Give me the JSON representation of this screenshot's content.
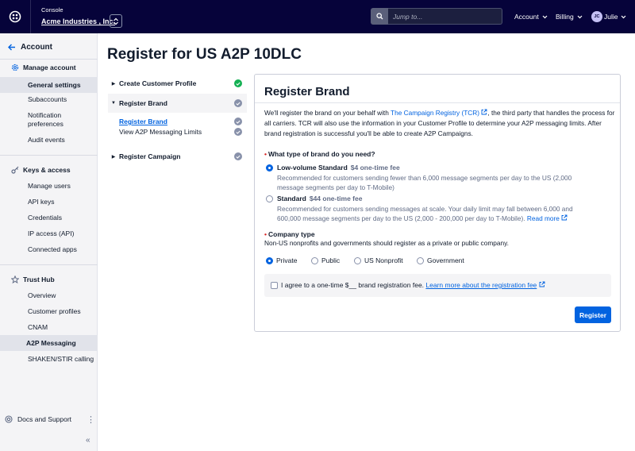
{
  "topbar": {
    "console_label": "Console",
    "account_name": "Acme Industries , Inc.",
    "search_placeholder": "Jump to...",
    "account_menu": "Account",
    "billing_menu": "Billing",
    "avatar_initials": "JC",
    "user_name": "Julie"
  },
  "sidebar": {
    "back_label": "Account",
    "manage_account": "Manage account",
    "general_settings": "General settings",
    "subaccounts": "Subaccounts",
    "notification_prefs_line1": "Notification",
    "notification_prefs_line2": "preferences",
    "audit_events": "Audit events",
    "keys_access": "Keys & access",
    "manage_users": "Manage users",
    "api_keys": "API keys",
    "credentials": "Credentials",
    "ip_access": "IP access (API)",
    "connected_apps": "Connected apps",
    "trust_hub": "Trust Hub",
    "overview": "Overview",
    "customer_profiles": "Customer profiles",
    "cnam": "CNAM",
    "a2p_messaging": "A2P Messaging",
    "shaken_stir": "SHAKEN/STIR calling",
    "docs_support": "Docs and Support"
  },
  "page": {
    "title": "Register for US A2P 10DLC"
  },
  "steps": {
    "create_profile": "Create Customer Profile",
    "register_brand": "Register Brand",
    "sub_register_brand": "Register Brand",
    "sub_view_limits": "View A2P Messaging Limits",
    "register_campaign": "Register Campaign"
  },
  "card": {
    "title": "Register Brand",
    "intro_part1": "We'll register the brand on your behalf with ",
    "intro_link": "The Campaign Registry (TCR)",
    "intro_part2": ", the third party that handles the process for all carriers. TCR will also use the information in your Customer Profile to determine your A2P messaging limits. After brand registration is successful you'll be able to create A2P Campaigns.",
    "brand_question": "What type of brand do you need?",
    "low_volume_title": "Low-volume Standard",
    "low_volume_fee": "$4 one-time fee",
    "low_volume_desc": "Recommended for customers sending fewer than 6,000 message segments per day to the US (2,000 message segments per day to T-Mobile)",
    "standard_title": "Standard",
    "standard_fee": "$44 one-time fee",
    "standard_desc": "Recommended for customers sending messages at scale. Your daily limit may fall between 6,000 and 600,000 message segments per day to the US (2,000 - 200,000 per day to T-Mobile).",
    "read_more": "Read more",
    "company_type_label": "Company type",
    "company_type_help": "Non-US nonprofits and governments should register as a private or public company.",
    "company_types": [
      "Private",
      "Public",
      "US Nonprofit",
      "Government"
    ],
    "agree_text": "I agree to a one-time $__ brand registration fee.",
    "agree_link": "Learn more about the registration fee",
    "register_button": "Register"
  },
  "colors": {
    "topbar_bg": "#06033a",
    "primary": "#0263e0",
    "success": "#14b053",
    "required": "#d61f1f"
  }
}
